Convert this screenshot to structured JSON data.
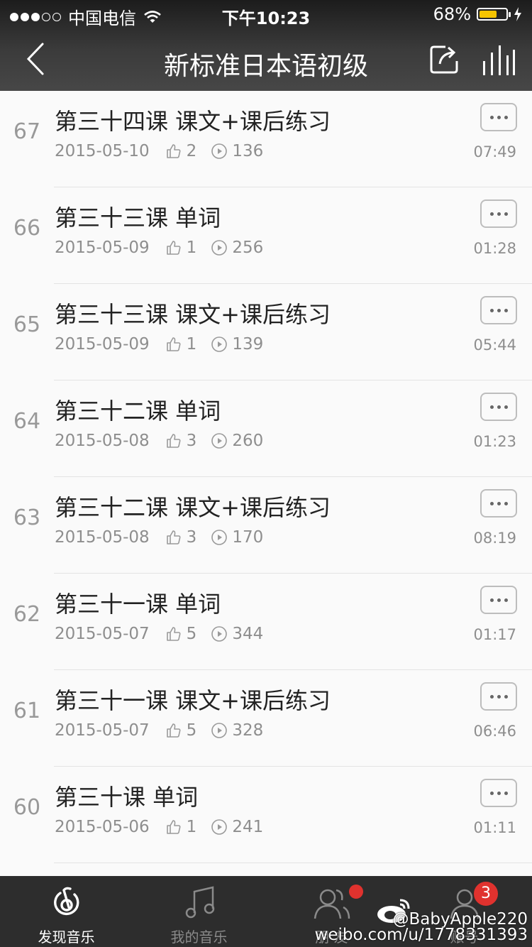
{
  "status": {
    "carrier": "中国电信",
    "time": "下午10:23",
    "battery": "68%",
    "battery_level": 0.68
  },
  "nav": {
    "title": "新标准日本语初级"
  },
  "list": [
    {
      "num": "67",
      "title": "第三十四课 课文+课后练习",
      "date": "2015-05-10",
      "likes": "2",
      "plays": "136",
      "duration": "07:49"
    },
    {
      "num": "66",
      "title": "第三十三课 单词",
      "date": "2015-05-09",
      "likes": "1",
      "plays": "256",
      "duration": "01:28"
    },
    {
      "num": "65",
      "title": "第三十三课  课文+课后练习",
      "date": "2015-05-09",
      "likes": "1",
      "plays": "139",
      "duration": "05:44"
    },
    {
      "num": "64",
      "title": "第三十二课 单词",
      "date": "2015-05-08",
      "likes": "3",
      "plays": "260",
      "duration": "01:23"
    },
    {
      "num": "63",
      "title": "第三十二课 课文+课后练习",
      "date": "2015-05-08",
      "likes": "3",
      "plays": "170",
      "duration": "08:19"
    },
    {
      "num": "62",
      "title": "第三十一课 单词",
      "date": "2015-05-07",
      "likes": "5",
      "plays": "344",
      "duration": "01:17"
    },
    {
      "num": "61",
      "title": "第三十一课 课文+课后练习",
      "date": "2015-05-07",
      "likes": "5",
      "plays": "328",
      "duration": "06:46"
    },
    {
      "num": "60",
      "title": "第三十课 单词",
      "date": "2015-05-06",
      "likes": "1",
      "plays": "241",
      "duration": "01:11"
    }
  ],
  "tabs": [
    {
      "label": "发现音乐",
      "icon": "discover-music-icon"
    },
    {
      "label": "我的音乐",
      "icon": "music-note-icon"
    },
    {
      "label": "朋 友",
      "icon": "friends-icon"
    },
    {
      "label": "账号",
      "icon": "account-icon"
    }
  ],
  "badges": {
    "account_count": "3"
  },
  "watermark": {
    "handle": "@BabyApple220",
    "url": "weibo.com/u/1778331393"
  },
  "colors": {
    "accent": "#e0322e",
    "battery": "#f5c400"
  }
}
